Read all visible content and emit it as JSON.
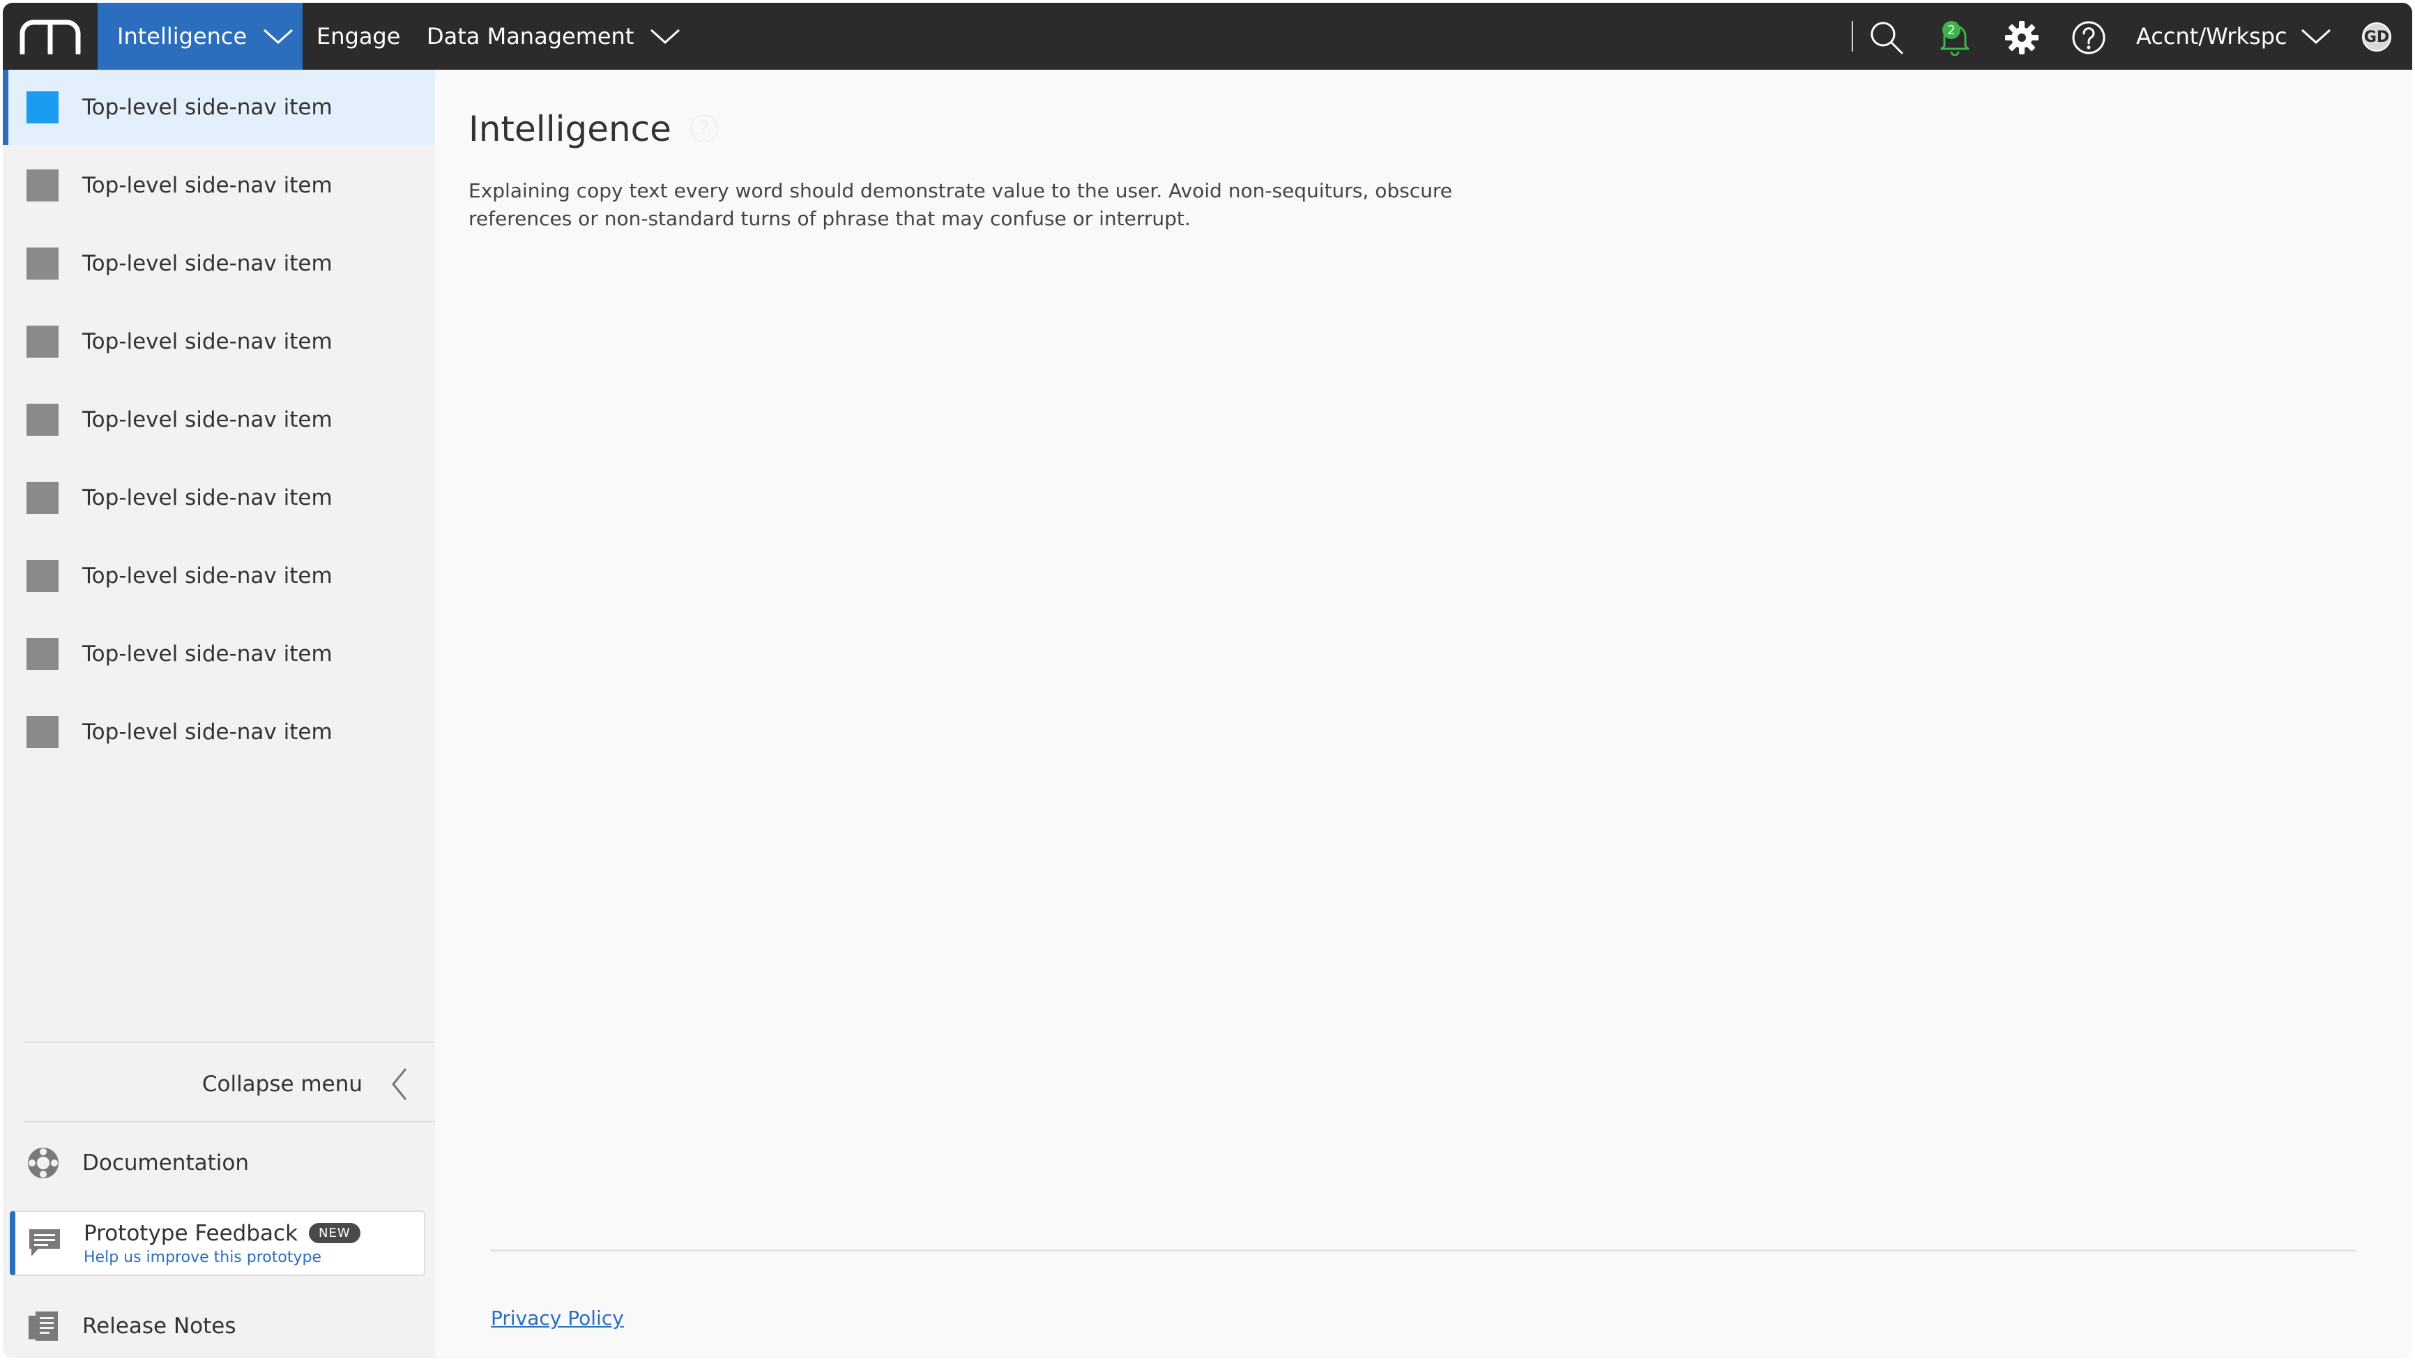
{
  "topbar": {
    "nav": {
      "intelligence": "Intelligence",
      "engage": "Engage",
      "data_management": "Data Management"
    },
    "notifications_count": "2",
    "account": "Accnt/Wrkspc",
    "avatar_initials": "GD",
    "colors": {
      "bar": "#2b2b2b",
      "active_tab": "#2b6ebd",
      "badge": "#3cb44a"
    }
  },
  "sidebar": {
    "items": [
      {
        "label": "Top-level side-nav item",
        "active": true
      },
      {
        "label": "Top-level side-nav item",
        "active": false
      },
      {
        "label": "Top-level side-nav item",
        "active": false
      },
      {
        "label": "Top-level side-nav item",
        "active": false
      },
      {
        "label": "Top-level side-nav item",
        "active": false
      },
      {
        "label": "Top-level side-nav item",
        "active": false
      },
      {
        "label": "Top-level side-nav item",
        "active": false
      },
      {
        "label": "Top-level side-nav item",
        "active": false
      },
      {
        "label": "Top-level side-nav item",
        "active": false
      }
    ],
    "collapse_label": "Collapse menu",
    "documentation_label": "Documentation",
    "feedback": {
      "title": "Prototype Feedback",
      "badge": "NEW",
      "subtitle": "Help us improve this prototype"
    },
    "release_notes_label": "Release Notes"
  },
  "main": {
    "title": "Intelligence",
    "help_glyph": "?",
    "description": "Explaining copy text every word should demonstrate value to the user. Avoid non-sequiturs, obscure references or non-standard turns of phrase that may confuse or interrupt.",
    "footer_link": "Privacy Policy"
  }
}
